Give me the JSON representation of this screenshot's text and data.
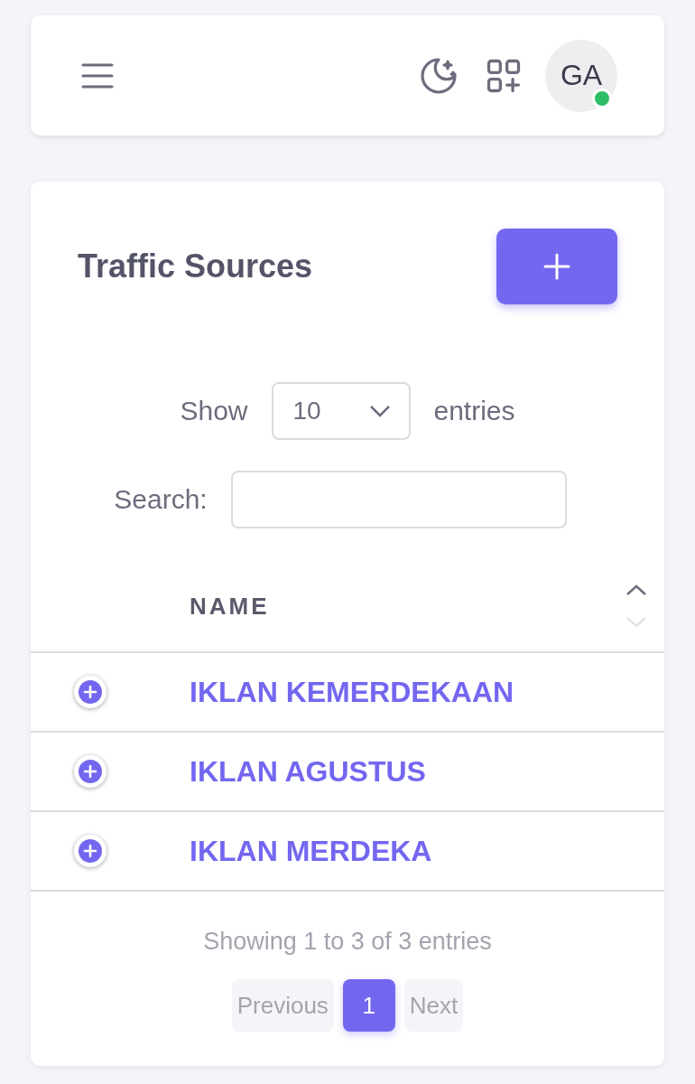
{
  "header": {
    "avatar": {
      "initials": "GA",
      "online": true
    }
  },
  "card": {
    "title": "Traffic Sources",
    "length": {
      "label_before": "Show",
      "value": "10",
      "label_after": "entries"
    },
    "search": {
      "label": "Search:"
    },
    "table": {
      "columns": [
        {
          "label": "NAME",
          "sorted_ascending": true
        }
      ],
      "rows": [
        {
          "name": "IKLAN KEMERDEKAAN"
        },
        {
          "name": "IKLAN AGUSTUS"
        },
        {
          "name": "IKLAN MERDEKA"
        }
      ]
    },
    "info": "Showing 1 to 3 of 3 entries",
    "pagination": [
      {
        "label": "Previous",
        "disabled": true,
        "selected": false
      },
      {
        "label": "1",
        "disabled": false,
        "selected": true
      },
      {
        "label": "Next",
        "disabled": true,
        "selected": false
      }
    ]
  }
}
